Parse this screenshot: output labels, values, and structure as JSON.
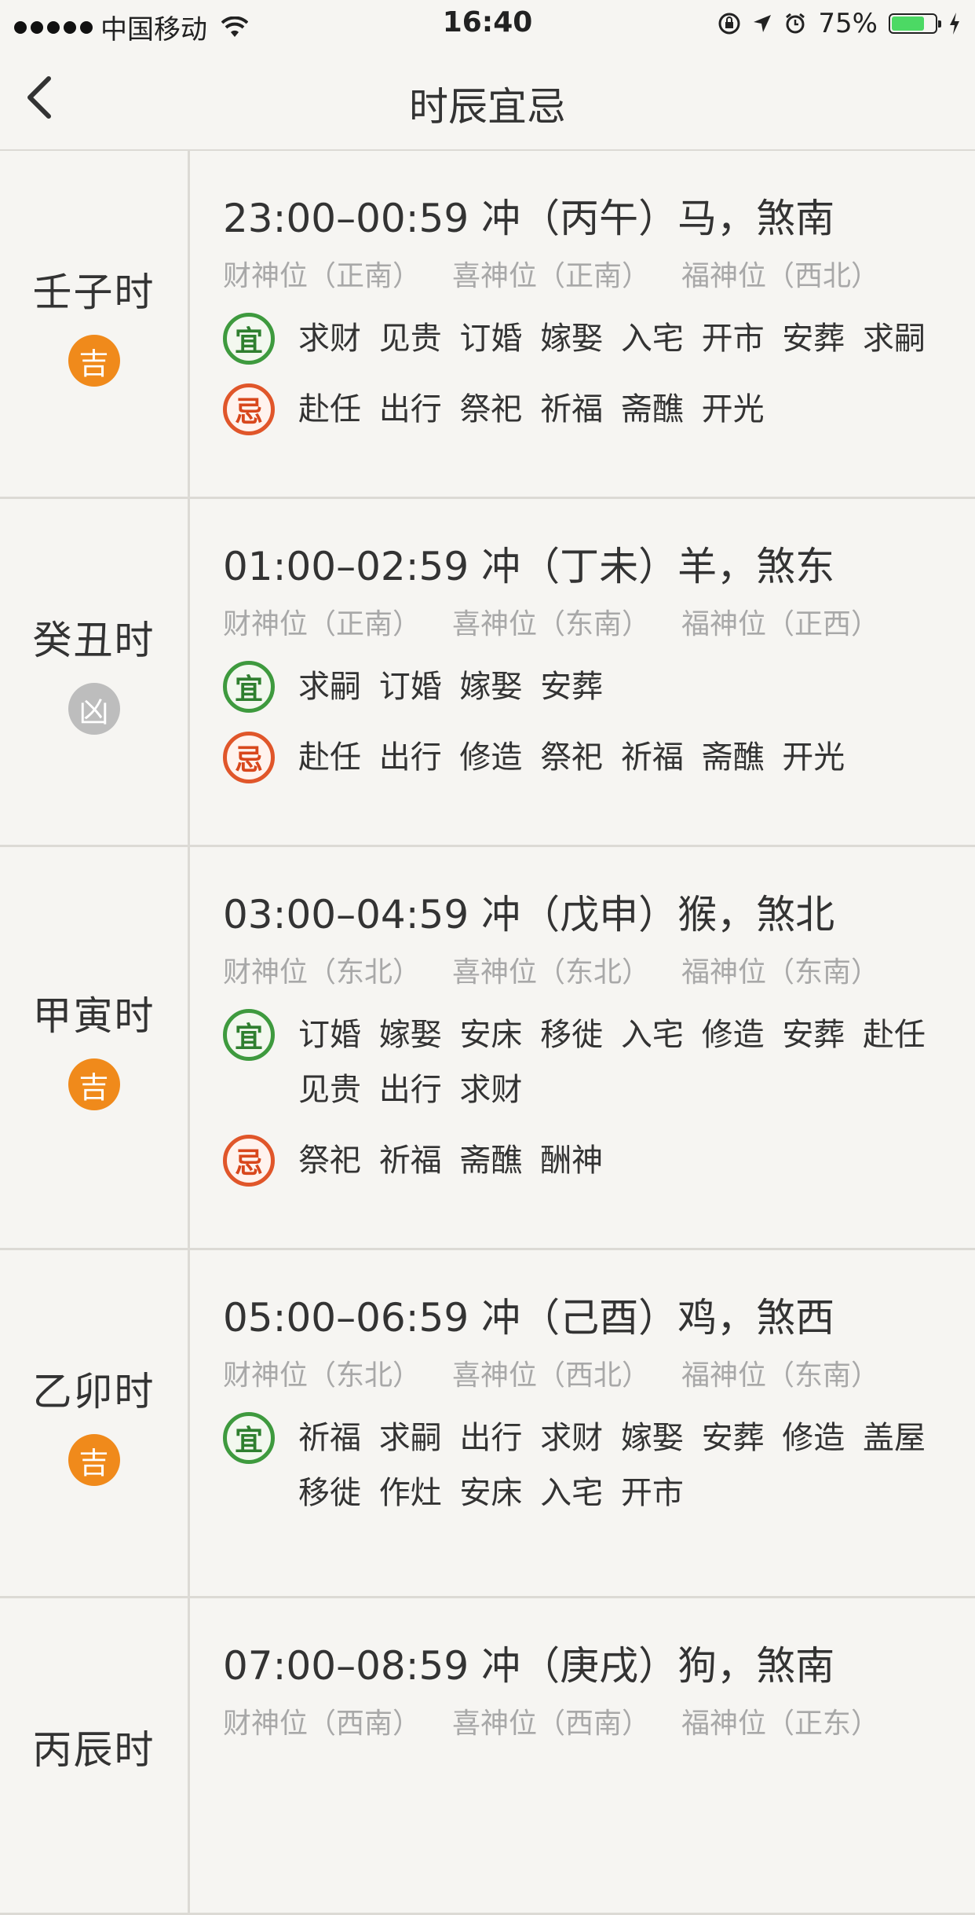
{
  "status": {
    "carrier": "中国移动",
    "time": "16:40",
    "battery": "75%",
    "battery_level": 0.75
  },
  "nav": {
    "title": "时辰宜忌"
  },
  "rows": [
    {
      "name": "壬子时",
      "luck": "吉",
      "luck_type": "good",
      "headline": "23:00–00:59 冲（丙午）马，煞南",
      "wealth": "财神位（正南）",
      "joy": "喜神位（正南）",
      "fortune": "福神位（西北）",
      "yi_icon": "宜",
      "yi": "求财 见贵 订婚 嫁娶 入宅 开市 安葬 求嗣",
      "ji_icon": "忌",
      "ji": "赴任 出行 祭祀 祈福 斋醮 开光"
    },
    {
      "name": "癸丑时",
      "luck": "凶",
      "luck_type": "bad",
      "headline": "01:00–02:59 冲（丁未）羊，煞东",
      "wealth": "财神位（正南）",
      "joy": "喜神位（东南）",
      "fortune": "福神位（正西）",
      "yi_icon": "宜",
      "yi": "求嗣 订婚 嫁娶 安葬",
      "ji_icon": "忌",
      "ji": "赴任 出行 修造 祭祀 祈福 斋醮 开光"
    },
    {
      "name": "甲寅时",
      "luck": "吉",
      "luck_type": "good",
      "headline": "03:00–04:59 冲（戊申）猴，煞北",
      "wealth": "财神位（东北）",
      "joy": "喜神位（东北）",
      "fortune": "福神位（东南）",
      "yi_icon": "宜",
      "yi": "订婚 嫁娶 安床 移徙 入宅 修造 安葬 赴任 见贵 出行 求财",
      "ji_icon": "忌",
      "ji": "祭祀 祈福 斋醮 酬神"
    },
    {
      "name": "乙卯时",
      "luck": "吉",
      "luck_type": "good",
      "headline": "05:00–06:59 冲（己酉）鸡，煞西",
      "wealth": "财神位（东北）",
      "joy": "喜神位（西北）",
      "fortune": "福神位（东南）",
      "yi_icon": "宜",
      "yi": "祈福 求嗣 出行 求财 嫁娶 安葬 修造 盖屋 移徙 作灶 安床 入宅 开市",
      "ji_icon": "",
      "ji": ""
    },
    {
      "name": "丙辰时",
      "luck": "",
      "luck_type": "good",
      "headline": "07:00–08:59 冲（庚戌）狗，煞南",
      "wealth": "财神位（西南）",
      "joy": "喜神位（西南）",
      "fortune": "福神位（正东）",
      "yi_icon": "",
      "yi": "",
      "ji_icon": "",
      "ji": ""
    }
  ]
}
